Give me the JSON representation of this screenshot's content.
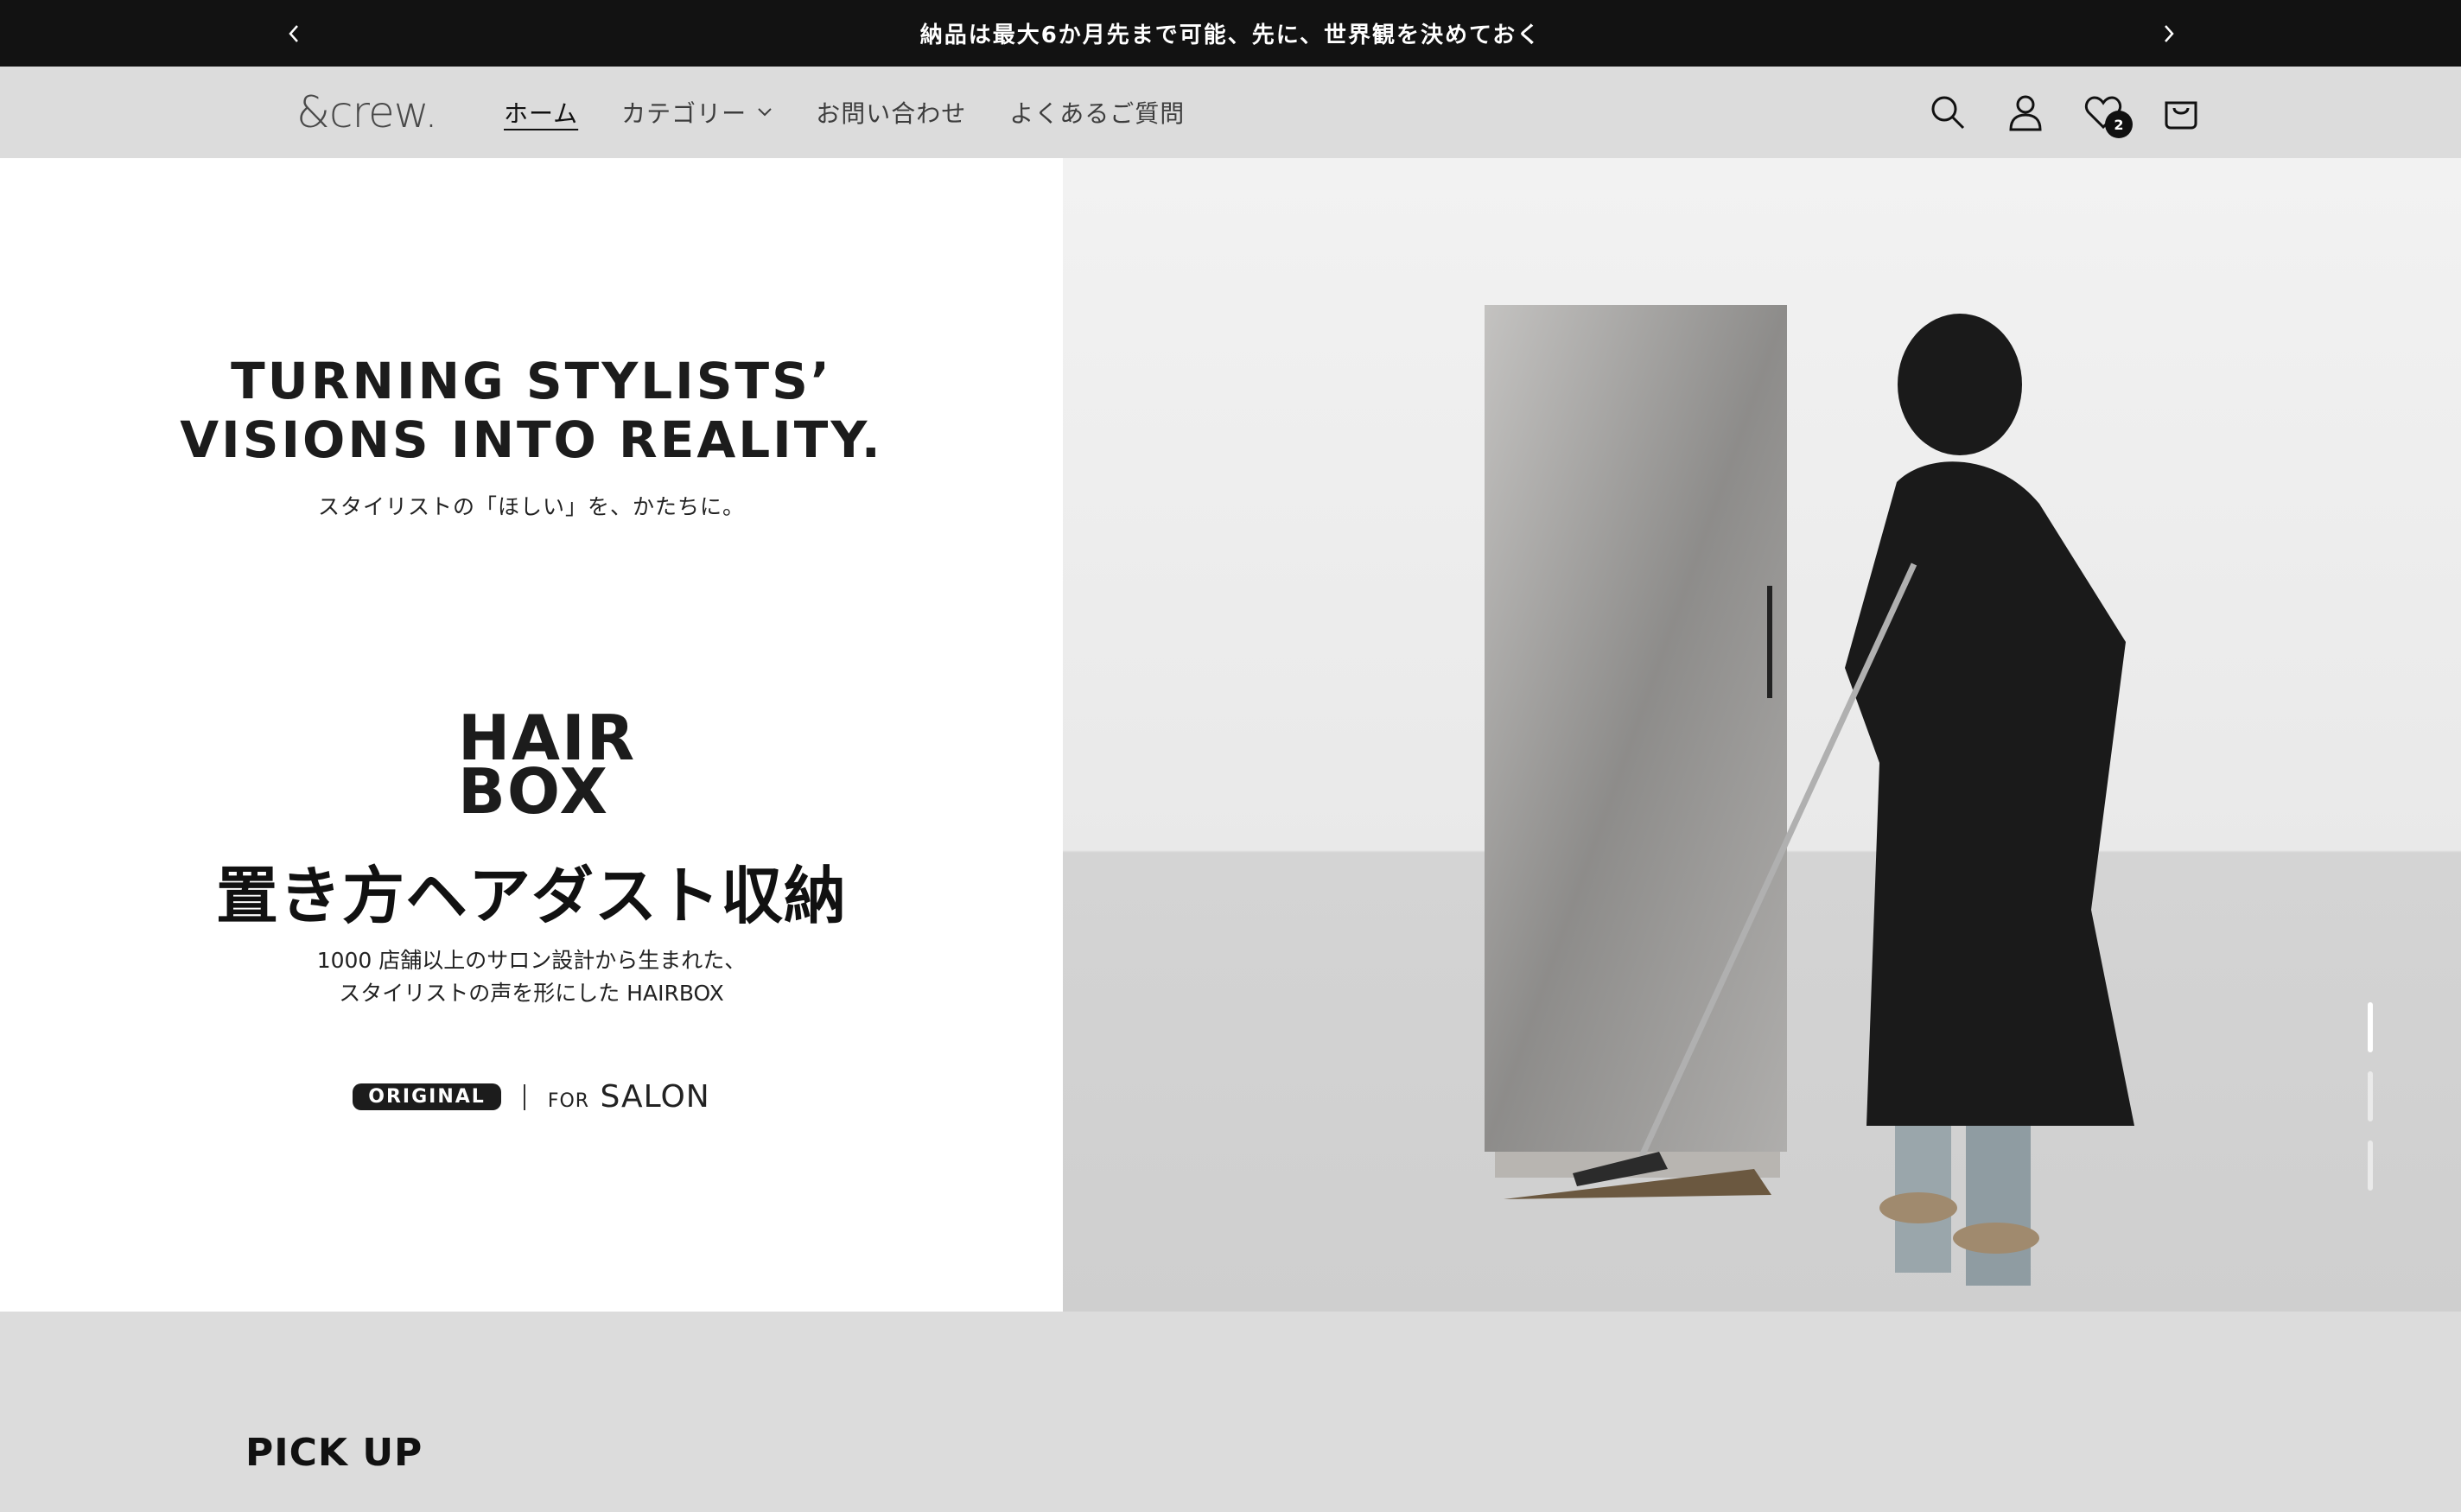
{
  "announcement": {
    "text": "納品は最大6か月先まで可能、先に、世界観を決めておく"
  },
  "header": {
    "logo": "&crew.",
    "nav": [
      {
        "label": "ホーム"
      },
      {
        "label": "カテゴリー"
      },
      {
        "label": "お問い合わせ"
      },
      {
        "label": "よくあるご質問"
      }
    ],
    "wishlist_count": "2"
  },
  "hero": {
    "tagline_line1": "TURNING STYLISTS’",
    "tagline_line2": "VISIONS INTO REALITY.",
    "tagline_sub": "スタイリストの「ほしい」を、かたちに。",
    "brand_line1": "HAIR",
    "brand_line2": "BOX",
    "title": "置き方ヘアダスト収納",
    "desc_line1": "1000 店舗以上のサロン設計から生まれた、",
    "desc_line2": "スタイリストの声を形にした HAIRBOX",
    "tag_original": "ORIGINAL",
    "tag_for": "FOR",
    "tag_salon": "SALON"
  },
  "section": {
    "pickup_title": "PICK UP"
  },
  "colors": {
    "announcement_bg": "#121212",
    "header_bg": "#dcdcdc",
    "cabinet": "#9c9a97"
  }
}
